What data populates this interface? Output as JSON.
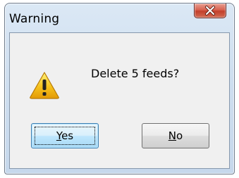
{
  "dialog": {
    "title": "Warning",
    "message": "Delete 5 feeds?",
    "icon": "warning-icon",
    "close_icon": "close-icon"
  },
  "buttons": {
    "yes": {
      "access_key": "Y",
      "rest": "es"
    },
    "no": {
      "access_key": "N",
      "rest": "o"
    }
  },
  "colors": {
    "frame": "#cfdff0",
    "client": "#f0f0f0",
    "close_button": "#c2402c",
    "default_button_border": "#3c7fb1",
    "warning_yellow": "#f6c21c"
  }
}
